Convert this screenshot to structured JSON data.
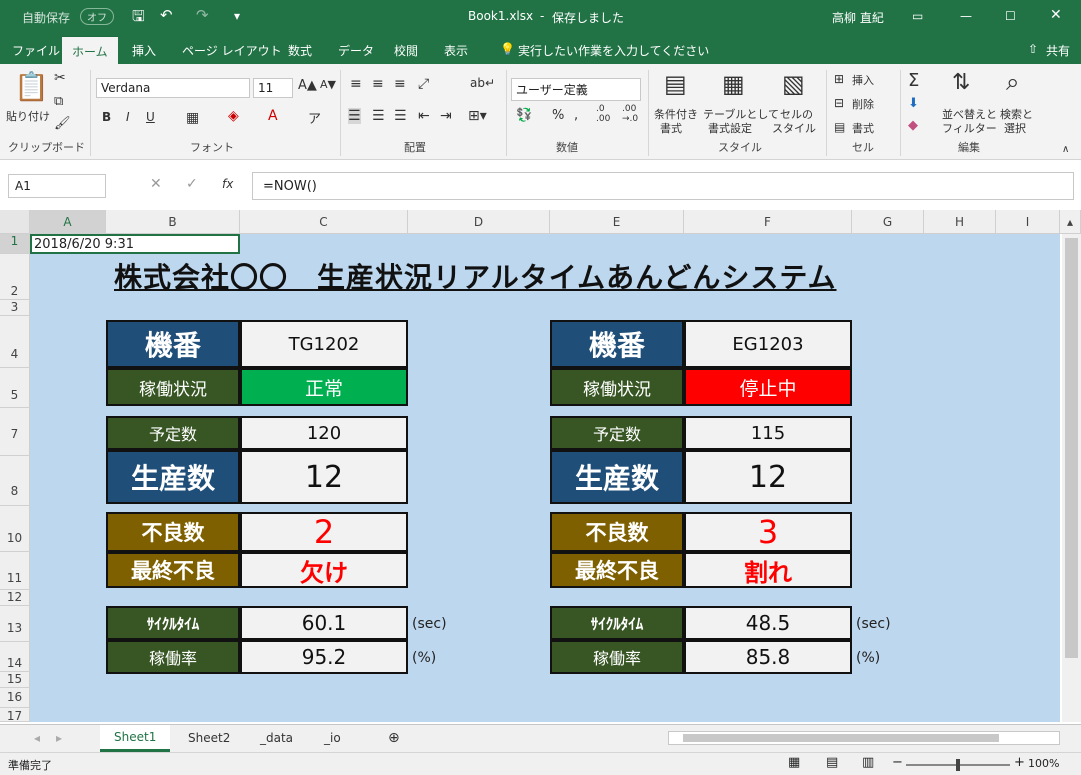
{
  "titlebar": {
    "autosave": "自動保存",
    "autosave_state": "オフ",
    "file": "Book1.xlsx",
    "sep": "-",
    "saved": "保存しました",
    "user": "高柳 直紀"
  },
  "tabs": [
    "ファイル",
    "ホーム",
    "挿入",
    "ページ レイアウト",
    "数式",
    "データ",
    "校閲",
    "表示"
  ],
  "tell_me": "実行したい作業を入力してください",
  "share": "共有",
  "ribbon": {
    "paste": "貼り付け",
    "clipboard": "クリップボード",
    "font_name": "Verdana",
    "font_size": "11",
    "font_group": "フォント",
    "align_group": "配置",
    "number_format": "ユーザー定義",
    "number_group": "数値",
    "cond_format": "条件付き",
    "cond_format2": "書式",
    "table_format": "テーブルとして",
    "table_format2": "書式設定",
    "cell_style": "セルの",
    "cell_style2": "スタイル",
    "style_group": "スタイル",
    "insert": "挿入",
    "delete": "削除",
    "format": "書式",
    "cells_group": "セル",
    "sort": "並べ替えと",
    "sort2": "フィルター",
    "find": "検索と",
    "find2": "選択",
    "edit_group": "編集"
  },
  "formula_bar": {
    "namebox": "A1",
    "fx": "fx",
    "formula": "=NOW()"
  },
  "columns": [
    "A",
    "B",
    "C",
    "D",
    "E",
    "F",
    "G",
    "H",
    "I"
  ],
  "rows": [
    "1",
    "2",
    "3",
    "4",
    "5",
    "7",
    "8",
    "10",
    "11",
    "12",
    "13",
    "14",
    "15",
    "16",
    "17"
  ],
  "sheet": {
    "a1": "2018/6/20 9:31",
    "title": "株式会社〇〇　生産状況リアルタイムあんどんシステム",
    "m1": {
      "machine_label": "機番",
      "machine": "TG1202",
      "status_label": "稼働状況",
      "status": "正常",
      "plan_label": "予定数",
      "plan": "120",
      "prod_label": "生産数",
      "prod": "12",
      "defect_label": "不良数",
      "defect": "2",
      "last_label": "最終不良",
      "last": "欠け",
      "cycle_label": "ｻｲｸﾙﾀｲﾑ",
      "cycle": "60.1",
      "cycle_unit": "(sec)",
      "rate_label": "稼働率",
      "rate": "95.2",
      "rate_unit": "(%)"
    },
    "m2": {
      "machine_label": "機番",
      "machine": "EG1203",
      "status_label": "稼働状況",
      "status": "停止中",
      "plan_label": "予定数",
      "plan": "115",
      "prod_label": "生産数",
      "prod": "12",
      "defect_label": "不良数",
      "defect": "3",
      "last_label": "最終不良",
      "last": "割れ",
      "cycle_label": "ｻｲｸﾙﾀｲﾑ",
      "cycle": "48.5",
      "cycle_unit": "(sec)",
      "rate_label": "稼働率",
      "rate": "85.8",
      "rate_unit": "(%)"
    }
  },
  "sheet_tabs": [
    "Sheet1",
    "Sheet2",
    "_data",
    "_io"
  ],
  "status": {
    "ready": "準備完了",
    "zoom": "100%"
  },
  "colors": {
    "ok": "#00b050",
    "stop": "#ff0000",
    "navy": "#1f4e79",
    "green": "#375623",
    "brown": "#7f6000"
  }
}
